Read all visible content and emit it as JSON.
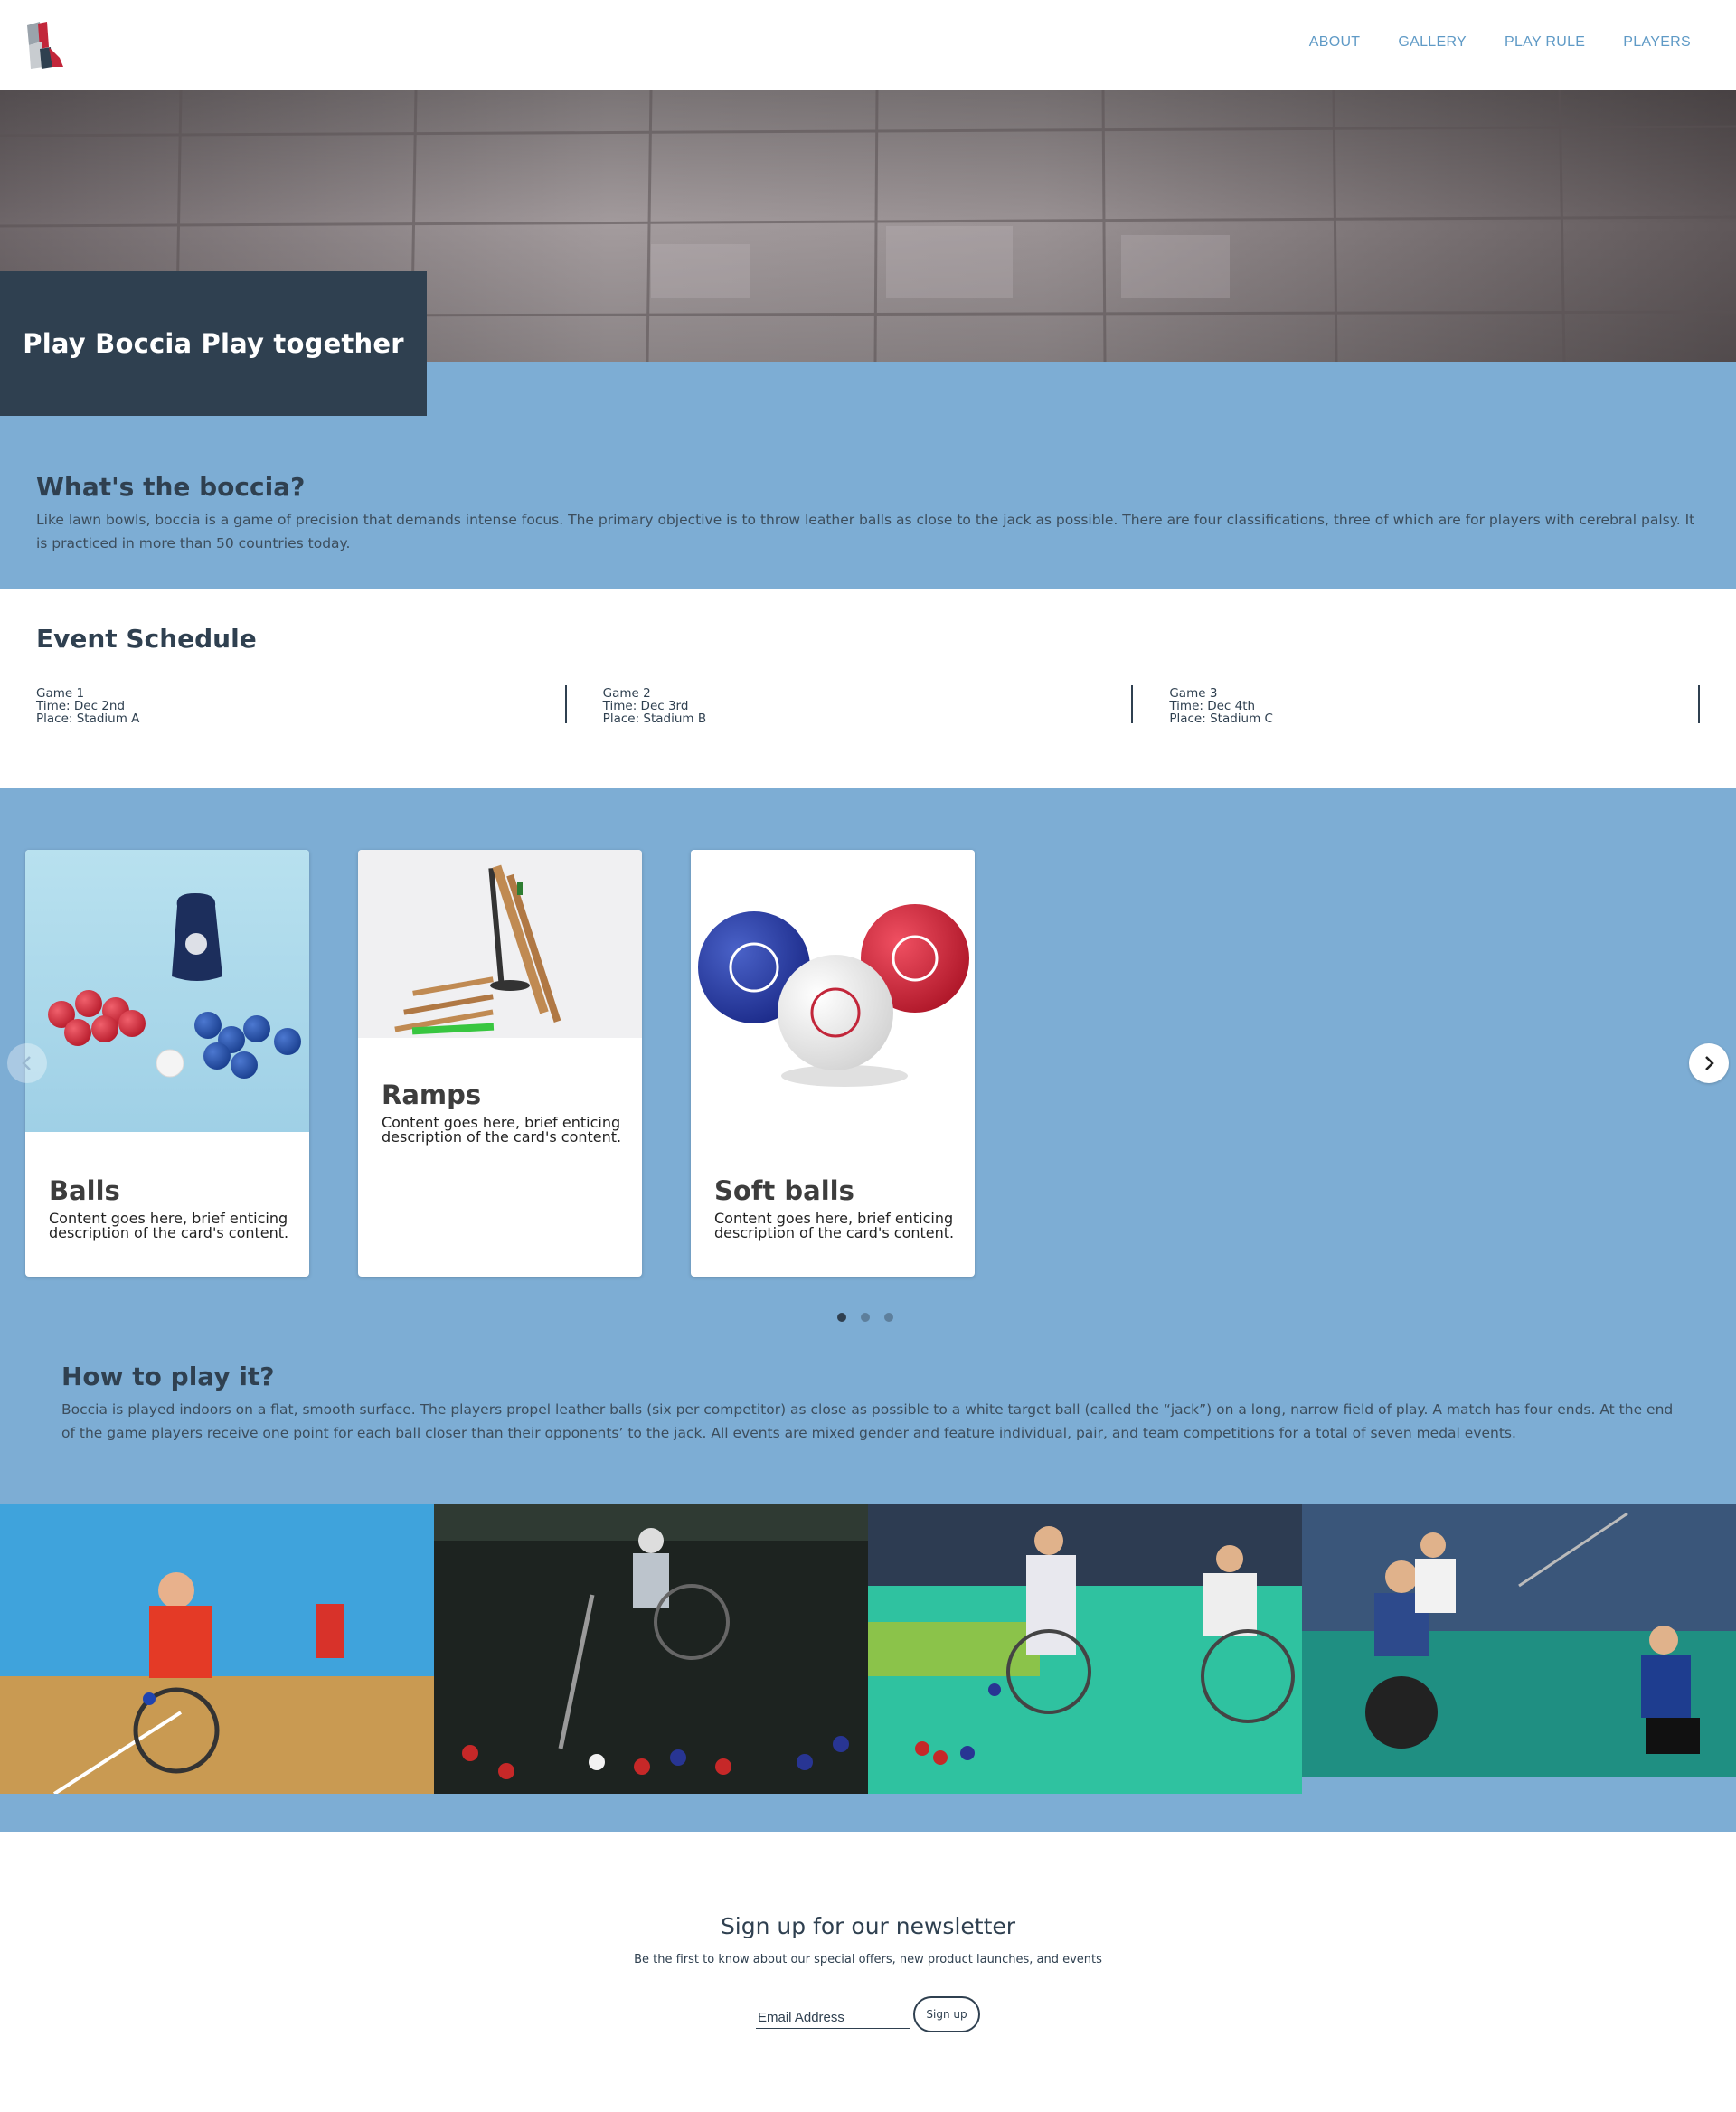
{
  "nav": {
    "items": [
      {
        "label": "ABOUT"
      },
      {
        "label": "GALLERY"
      },
      {
        "label": "PLAY RULE"
      },
      {
        "label": "PLAYERS"
      }
    ]
  },
  "hero": {
    "headline": "Play Boccia Play together"
  },
  "about": {
    "title": "What's the boccia?",
    "body": "Like lawn bowls, boccia is a game of precision that demands intense focus. The primary objective is to throw leather balls as close to the jack as possible. There are four classifications, three of which are for players with cerebral palsy. It is practiced in more than 50 countries today."
  },
  "schedule": {
    "title": "Event Schedule",
    "games": [
      {
        "name": "Game 1",
        "time": "Time: Dec 2nd",
        "place": "Place: Stadium A"
      },
      {
        "name": "Game 2",
        "time": "Time: Dec 3rd",
        "place": "Place: Stadium B"
      },
      {
        "name": "Game 3",
        "time": "Time: Dec 4th",
        "place": "Place: Stadium C"
      }
    ]
  },
  "products": {
    "cards": [
      {
        "title": "Balls",
        "description": "Content goes here, brief enticing description of the card's content."
      },
      {
        "title": "Ramps",
        "description": "Content goes here, brief enticing description of the card's content."
      },
      {
        "title": "Soft balls",
        "description": "Content goes here, brief enticing description of the card's content."
      }
    ],
    "pagination": {
      "active": 1,
      "count": 3
    }
  },
  "howto": {
    "title": "How to play it?",
    "body": "Boccia is played indoors on a flat, smooth surface. The players propel leather balls (six per competitor) as close as possible to a white target ball (called the “jack”) on a long, narrow field of play. A match has four ends. At the end of the game players receive one point for each ball closer than their opponents’ to the jack. All events are mixed gender and feature individual, pair, and team competitions for a total of seven medal events."
  },
  "newsletter": {
    "title": "Sign up for our newsletter",
    "subtitle": "Be the first to know about our special offers, new product launches, and events",
    "email_placeholder": "Email Address",
    "button_label": "Sign up"
  },
  "colors": {
    "brand_blue": "#7dadd4",
    "dark_navy": "#2f4050",
    "nav_link": "#5f9ac6",
    "logo_red": "#c2263a"
  },
  "icons": [
    "brand-logo-icon",
    "chevron-left-icon",
    "chevron-right-icon"
  ]
}
